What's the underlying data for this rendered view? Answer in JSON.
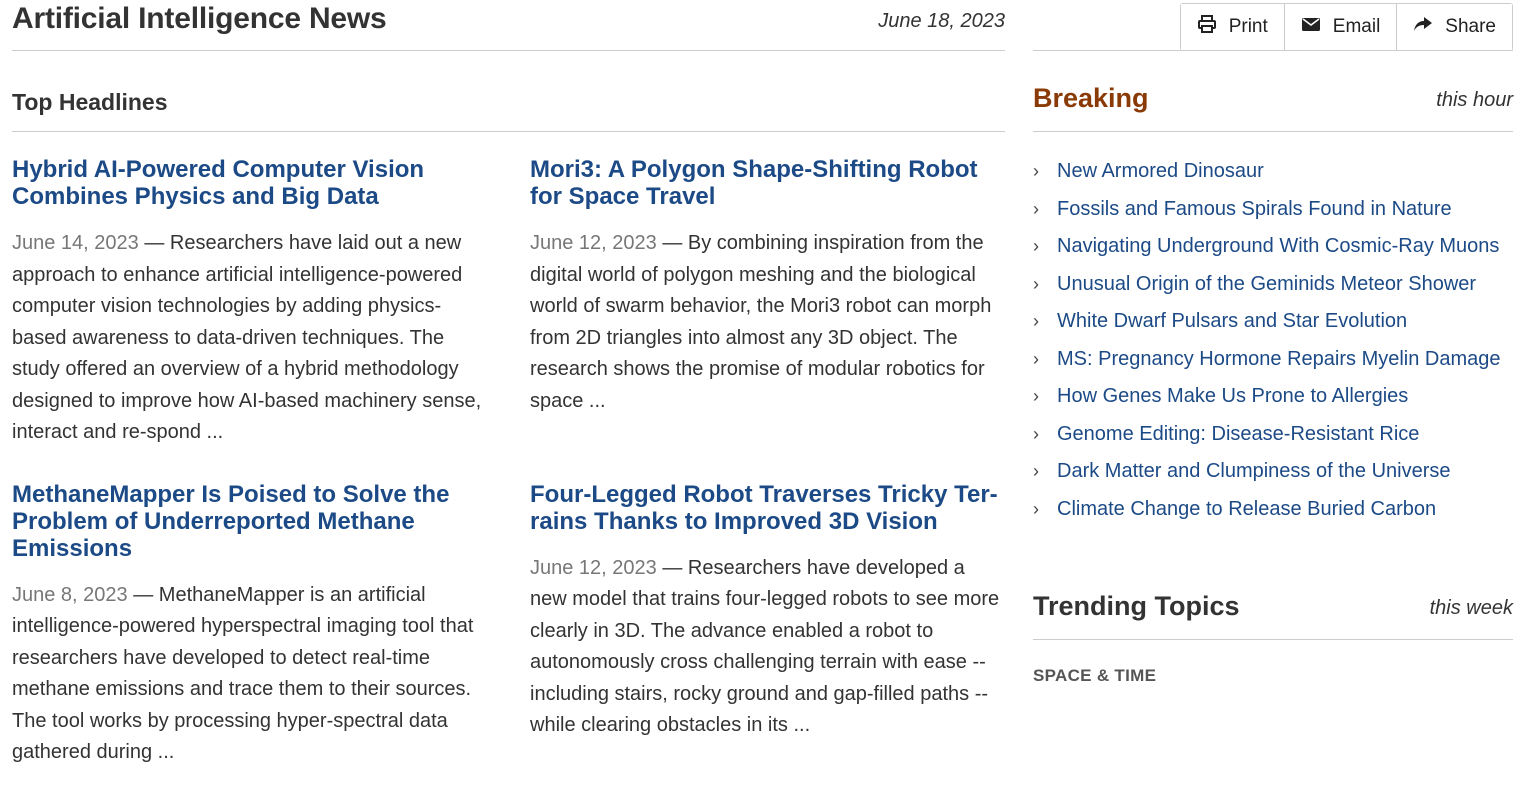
{
  "masthead": {
    "title": "Artificial Intelligence News",
    "date": "June 18, 2023"
  },
  "section": {
    "label": "Top Headlines"
  },
  "stories": [
    {
      "headline": "Hybrid AI-Powered Computer Vision Combines Physics and Big Data",
      "date": "June 14, 2023",
      "summary": "Researchers have laid out a new approach to enhance artificial intelligence-powered computer vision technologies by adding physics-based awareness to data-driven techniques. The study offered an overview of a hybrid methodology designed to improve how AI-based machinery sense, interact and re-spond ..."
    },
    {
      "headline": "Mori3: A Polygon Shape-Shifting Robot for Space Travel",
      "date": "June 12, 2023",
      "summary": "By combining inspiration from the digital world of polygon meshing and the biological world of swarm behavior, the Mori3 robot can morph from 2D triangles into almost any 3D object. The research shows the promise of modular robotics for space ..."
    },
    {
      "headline": "MethaneMapper Is Poised to Solve the Problem of Underreported Methane Emissions",
      "date": "June 8, 2023",
      "summary": "MethaneMapper is an artificial intelligence-powered hyperspectral imaging tool that researchers have developed to detect real-time methane emissions and trace them to their sources. The tool works by processing hyper-spectral data gathered during ..."
    },
    {
      "headline": "Four-Legged Robot Traverses Tricky Ter-rains Thanks to Improved 3D Vision",
      "date": "June 12, 2023",
      "summary": "Researchers have developed a new model that trains four-legged robots to see more clearly in 3D. The advance enabled a robot to autonomously cross challenging terrain with ease -- including stairs, rocky ground and gap-filled paths -- while clearing obstacles in its ..."
    }
  ],
  "share": {
    "print": "Print",
    "email": "Email",
    "share": "Share"
  },
  "breaking": {
    "label": "Breaking",
    "when": "this hour",
    "items": [
      "New Armored Dinosaur",
      "Fossils and Famous Spirals Found in Nature",
      "Navigating Underground With Cosmic-Ray Muons",
      "Unusual Origin of the Geminids Meteor Shower",
      "White Dwarf Pulsars and Star Evolution",
      "MS: Pregnancy Hormone Repairs Myelin Damage",
      "How Genes Make Us Prone to Allergies",
      "Genome Editing: Disease-Resistant Rice",
      "Dark Matter and Clumpiness of the Universe",
      "Climate Change to Release Buried Carbon"
    ]
  },
  "trending": {
    "label": "Trending Topics",
    "when": "this week",
    "category": "SPACE & TIME"
  },
  "colors": {
    "headline": "#1c4a86",
    "breaking": "#8a3a06",
    "divider": "#cccccc"
  },
  "icons": {
    "print": "printer-icon",
    "email": "envelope-icon",
    "share": "share-arrow-icon",
    "bullet": "chevron-right-icon"
  }
}
